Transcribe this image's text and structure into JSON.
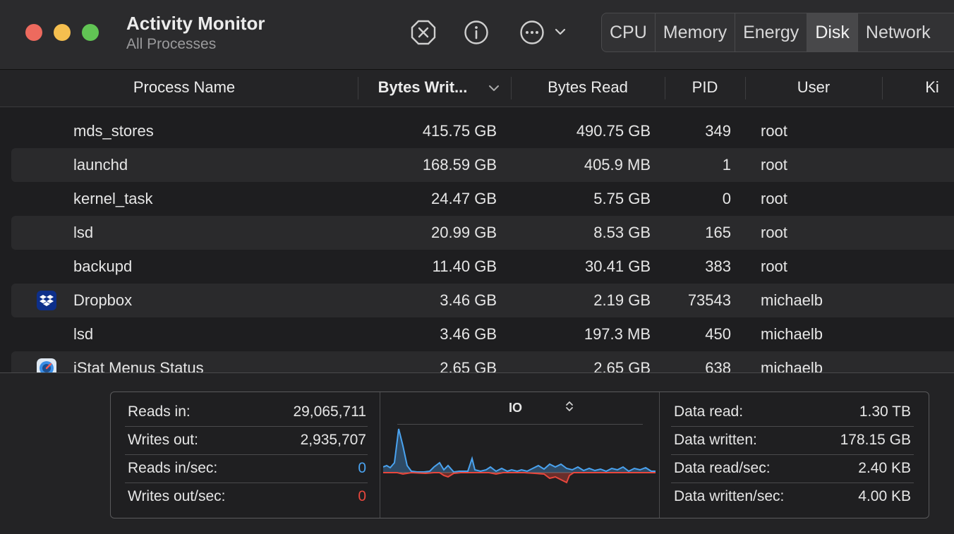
{
  "window": {
    "title": "Activity Monitor",
    "subtitle": "All Processes"
  },
  "toolbar": {
    "tabs": [
      {
        "label": "CPU",
        "active": false
      },
      {
        "label": "Memory",
        "active": false
      },
      {
        "label": "Energy",
        "active": false
      },
      {
        "label": "Disk",
        "active": true
      },
      {
        "label": "Network",
        "active": false
      }
    ]
  },
  "table": {
    "columns": [
      "Process Name",
      "Bytes Writ...",
      "Bytes Read",
      "PID",
      "User",
      "Ki"
    ],
    "rows": [
      {
        "name": "mds_stores",
        "bytes_written": "415.75 GB",
        "bytes_read": "490.75 GB",
        "pid": "349",
        "user": "root",
        "icon": ""
      },
      {
        "name": "launchd",
        "bytes_written": "168.59 GB",
        "bytes_read": "405.9 MB",
        "pid": "1",
        "user": "root",
        "icon": ""
      },
      {
        "name": "kernel_task",
        "bytes_written": "24.47 GB",
        "bytes_read": "5.75 GB",
        "pid": "0",
        "user": "root",
        "icon": ""
      },
      {
        "name": "lsd",
        "bytes_written": "20.99 GB",
        "bytes_read": "8.53 GB",
        "pid": "165",
        "user": "root",
        "icon": ""
      },
      {
        "name": "backupd",
        "bytes_written": "11.40 GB",
        "bytes_read": "30.41 GB",
        "pid": "383",
        "user": "root",
        "icon": ""
      },
      {
        "name": "Dropbox",
        "bytes_written": "3.46 GB",
        "bytes_read": "2.19 GB",
        "pid": "73543",
        "user": "michaelb",
        "icon": "dropbox-icon"
      },
      {
        "name": "lsd",
        "bytes_written": "3.46 GB",
        "bytes_read": "197.3 MB",
        "pid": "450",
        "user": "michaelb",
        "icon": ""
      },
      {
        "name": "iStat Menus Status",
        "bytes_written": "2.65 GB",
        "bytes_read": "2.65 GB",
        "pid": "638",
        "user": "michaelb",
        "icon": "istat-icon"
      }
    ]
  },
  "stats": {
    "left": [
      {
        "label": "Reads in:",
        "value": "29,065,711"
      },
      {
        "label": "Writes out:",
        "value": "2,935,707"
      },
      {
        "label": "Reads in/sec:",
        "value": "0"
      },
      {
        "label": "Writes out/sec:",
        "value": "0"
      }
    ],
    "graph_label": "IO",
    "right": [
      {
        "label": "Data read:",
        "value": "1.30 TB"
      },
      {
        "label": "Data written:",
        "value": "178.15 GB"
      },
      {
        "label": "Data read/sec:",
        "value": "2.40 KB"
      },
      {
        "label": "Data written/sec:",
        "value": "4.00 KB"
      }
    ]
  },
  "colors": {
    "read": "#4aa3f0",
    "write": "#e8473d"
  }
}
